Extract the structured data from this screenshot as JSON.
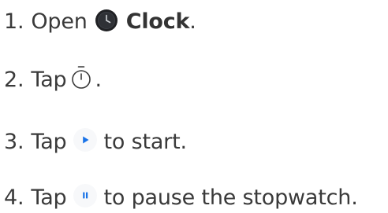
{
  "steps": [
    {
      "number": "1.",
      "before": "Open",
      "app_name": "Clock",
      "after": ".",
      "icon": "clock-app-icon"
    },
    {
      "number": "2.",
      "before": "Tap",
      "after": ".",
      "icon": "stopwatch-icon"
    },
    {
      "number": "3.",
      "before": "Tap",
      "after": "to start.",
      "icon": "play-icon"
    },
    {
      "number": "4.",
      "before": "Tap",
      "after": "to pause the stopwatch.",
      "icon": "pause-icon"
    }
  ],
  "colors": {
    "text": "#3a3a3a",
    "accent": "#1a73e8",
    "clock_icon_bg": "#202124"
  }
}
